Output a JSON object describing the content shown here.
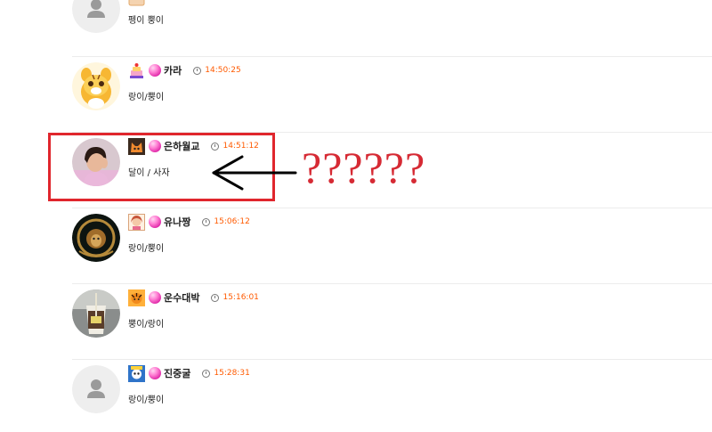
{
  "comments": [
    {
      "avatar": "default-user-icon",
      "badge": "gift-icon",
      "nickname": "",
      "time": "",
      "message": "펭이   뿡이"
    },
    {
      "avatar": "tiger-cartoon-avatar",
      "badge": "cake-badge-icon",
      "nickname": "카라",
      "time": "14:50:25",
      "message": "랑이/뿡이"
    },
    {
      "avatar": "person-photo-avatar",
      "badge": "fox-badge-icon",
      "nickname": "은하월교",
      "time": "14:51:12",
      "message": "달이 / 사자"
    },
    {
      "avatar": "lion-emblem-avatar",
      "badge": "girl-badge-icon",
      "nickname": "유나짱",
      "time": "15:06:12",
      "message": "랑이/뿡이"
    },
    {
      "avatar": "cup-photo-avatar",
      "badge": "tiger-badge-icon",
      "nickname": "운수대박",
      "time": "15:16:01",
      "message": "뿡이/랑이"
    },
    {
      "avatar": "default-user-icon",
      "badge": "blue-character-badge-icon",
      "nickname": "진중굴",
      "time": "15:28:31",
      "message": "랑이/뿡이"
    }
  ],
  "annotation": {
    "text": "??????",
    "color": "#d62a34"
  },
  "colors": {
    "time": "#ff5a00",
    "highlight_border": "#e0262d",
    "ball": "#ff5ac8"
  }
}
